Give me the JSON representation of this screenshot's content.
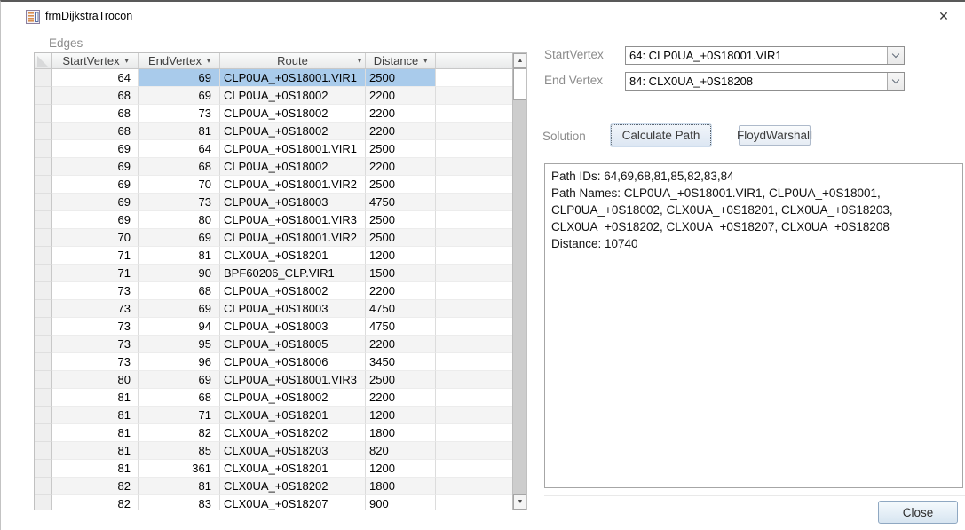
{
  "window": {
    "title": "frmDijkstraTrocon",
    "close_glyph": "✕"
  },
  "icons": {
    "form_icon": "access-form-icon",
    "filter_arrow": "▾",
    "scroll_up": "▲",
    "scroll_down": "▼",
    "combo_chevron": "chevron-down"
  },
  "edges": {
    "label": "Edges",
    "columns": [
      "StartVertex",
      "EndVertex",
      "Route",
      "Distance"
    ],
    "selected_row_index": 0,
    "rows": [
      [
        "64",
        "69",
        "CLP0UA_+0S18001.VIR1",
        "2500"
      ],
      [
        "68",
        "69",
        "CLP0UA_+0S18002",
        "2200"
      ],
      [
        "68",
        "73",
        "CLP0UA_+0S18002",
        "2200"
      ],
      [
        "68",
        "81",
        "CLP0UA_+0S18002",
        "2200"
      ],
      [
        "69",
        "64",
        "CLP0UA_+0S18001.VIR1",
        "2500"
      ],
      [
        "69",
        "68",
        "CLP0UA_+0S18002",
        "2200"
      ],
      [
        "69",
        "70",
        "CLP0UA_+0S18001.VIR2",
        "2500"
      ],
      [
        "69",
        "73",
        "CLP0UA_+0S18003",
        "4750"
      ],
      [
        "69",
        "80",
        "CLP0UA_+0S18001.VIR3",
        "2500"
      ],
      [
        "70",
        "69",
        "CLP0UA_+0S18001.VIR2",
        "2500"
      ],
      [
        "71",
        "81",
        "CLX0UA_+0S18201",
        "1200"
      ],
      [
        "71",
        "90",
        "BPF60206_CLP.VIR1",
        "1500"
      ],
      [
        "73",
        "68",
        "CLP0UA_+0S18002",
        "2200"
      ],
      [
        "73",
        "69",
        "CLP0UA_+0S18003",
        "4750"
      ],
      [
        "73",
        "94",
        "CLP0UA_+0S18003",
        "4750"
      ],
      [
        "73",
        "95",
        "CLP0UA_+0S18005",
        "2200"
      ],
      [
        "73",
        "96",
        "CLP0UA_+0S18006",
        "3450"
      ],
      [
        "80",
        "69",
        "CLP0UA_+0S18001.VIR3",
        "2500"
      ],
      [
        "81",
        "68",
        "CLP0UA_+0S18002",
        "2200"
      ],
      [
        "81",
        "71",
        "CLX0UA_+0S18201",
        "1200"
      ],
      [
        "81",
        "82",
        "CLX0UA_+0S18202",
        "1800"
      ],
      [
        "81",
        "85",
        "CLX0UA_+0S18203",
        "820"
      ],
      [
        "81",
        "361",
        "CLX0UA_+0S18201",
        "1200"
      ],
      [
        "82",
        "81",
        "CLX0UA_+0S18202",
        "1800"
      ],
      [
        "82",
        "83",
        "CLX0UA_+0S18207",
        "900"
      ]
    ]
  },
  "controls": {
    "start_vertex_label": "StartVertex",
    "start_vertex_value": "64: CLP0UA_+0S18001.VIR1",
    "end_vertex_label": "End Vertex",
    "end_vertex_value": "84: CLX0UA_+0S18208",
    "solution_label": "Solution",
    "calculate_path_button": "Calculate Path",
    "floyd_warshall_button": "FloydWarshall",
    "close_button": "Close"
  },
  "solution": {
    "text": "Path IDs: 64,69,68,81,85,82,83,84\nPath Names: CLP0UA_+0S18001.VIR1, CLP0UA_+0S18001,\nCLP0UA_+0S18002, CLX0UA_+0S18201, CLX0UA_+0S18203,\nCLX0UA_+0S18202, CLX0UA_+0S18207, CLX0UA_+0S18208\nDistance: 10740"
  },
  "colors": {
    "selection": "#a9cbeb",
    "label_gray": "#8c8c8c",
    "header_gradient_top": "#fafbfb",
    "header_gradient_bottom": "#e8e9ea",
    "button_border": "#aebacb",
    "close_button_border": "#8fa8c2"
  }
}
